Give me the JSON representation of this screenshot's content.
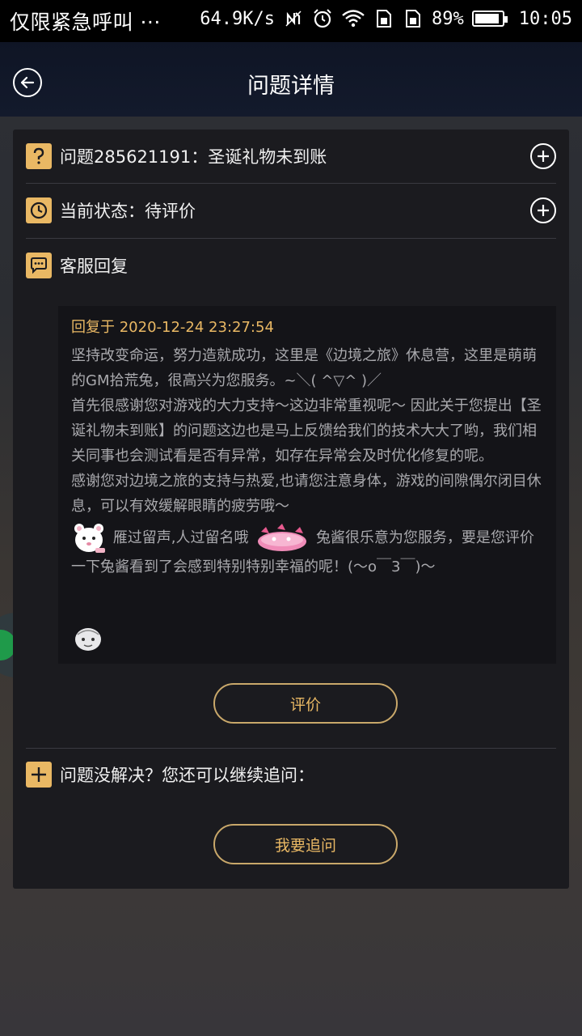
{
  "status_bar": {
    "carrier_text": "仅限紧急呼叫 ···",
    "speed": "64.9K/s",
    "battery": "89%",
    "time": "10:05",
    "icons": [
      "nfc-icon",
      "alarm-icon",
      "wifi-icon",
      "sim1-icon",
      "sim2-icon",
      "battery-icon"
    ]
  },
  "nav": {
    "title": "问题详情",
    "back_icon": "back-arrow-icon"
  },
  "issue": {
    "label": "问题285621191：圣诞礼物未到账",
    "icon": "question-icon"
  },
  "status": {
    "label": "当前状态：待评价",
    "icon": "clock-icon"
  },
  "reply_section": {
    "label": "客服回复",
    "icon": "chat-bubble-icon"
  },
  "reply": {
    "time": "回复于 2020-12-24 23:27:54",
    "paragraph1": "坚持改变命运，努力造就成功，这里是《边境之旅》休息营，这里是萌萌的GM拾荒兔，很高兴为您服务。~＼( ^▽^ )／",
    "paragraph2": "首先很感谢您对游戏的大力支持～这边非常重视呢～ 因此关于您提出【圣诞礼物未到账】的问题这边也是马上反馈给我们的技术大大了哟，我们相关同事也会测试看是否有异常，如存在异常会及时优化修复的呢。",
    "paragraph3": "感谢您对边境之旅的支持与热爱,也请您注意身体，游戏的间隙偶尔闭目休息，可以有效缓解眼睛的疲劳哦～",
    "paragraph4_a": "雁过留声,人过留名哦",
    "paragraph4_b": "兔酱很乐意为您服务，要是您评价一下兔酱看到了会感到特别特别幸福的呢！(～o￣3￣)～"
  },
  "buttons": {
    "rate": "评价",
    "follow_up": "我要追问"
  },
  "follow_up": {
    "label": "问题没解决？您还可以继续追问：",
    "icon": "plus-icon"
  },
  "colors": {
    "accent": "#e9b864",
    "card_bg": "#1b1b1f",
    "reply_bg": "#141418",
    "nav_bg": "#131a2c",
    "reply_text": "#a9a9ad"
  }
}
